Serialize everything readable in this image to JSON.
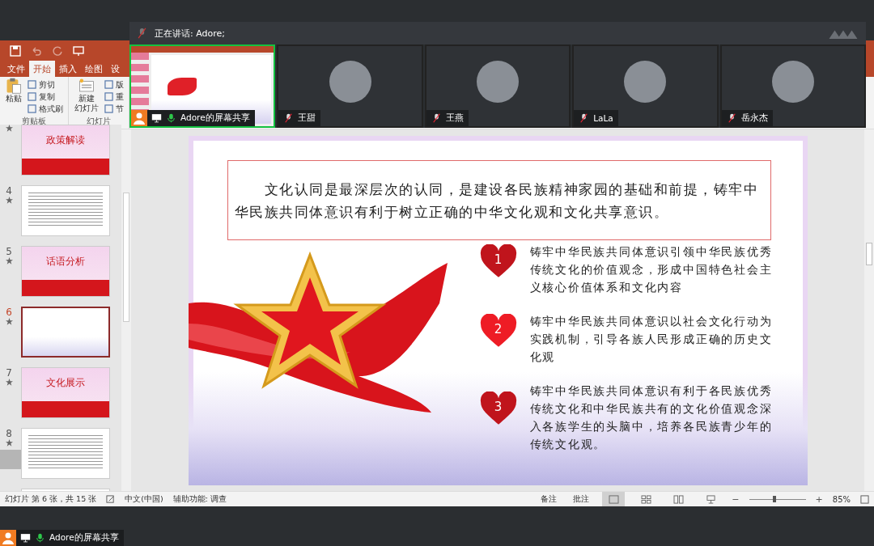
{
  "meeting": {
    "speaking": "正在讲话: Adore;",
    "tiles": [
      {
        "kind": "screen",
        "name": "Adore的屏幕共享",
        "selected": true
      },
      {
        "kind": "avatar",
        "name": "王甜",
        "selected": false
      },
      {
        "kind": "avatar",
        "name": "王燕",
        "selected": false
      },
      {
        "kind": "avatar",
        "name": "LaLa",
        "selected": false
      },
      {
        "kind": "avatar",
        "name": "岳永杰",
        "selected": false
      }
    ]
  },
  "tabs": [
    {
      "label": "文件",
      "selected": false
    },
    {
      "label": "开始",
      "selected": true
    },
    {
      "label": "插入",
      "selected": false
    },
    {
      "label": "绘图",
      "selected": false
    },
    {
      "label": "设",
      "selected": false
    }
  ],
  "ribbon": {
    "groups": [
      {
        "label": "剪贴板",
        "big": [
          "粘贴"
        ],
        "items": [
          "剪切",
          "复制",
          "格式刷"
        ]
      },
      {
        "label": "幻灯片",
        "big": [
          "新建",
          "幻灯片"
        ],
        "items": [
          "版",
          "重",
          "节"
        ]
      }
    ]
  },
  "thumbnails": [
    {
      "kind": "title",
      "title": "政策解读",
      "selected": false
    },
    {
      "kind": "text",
      "number": "4",
      "selected": false
    },
    {
      "kind": "title",
      "number": "5",
      "title": "话语分析",
      "selected": false
    },
    {
      "kind": "current",
      "number": "6",
      "selected": true
    },
    {
      "kind": "title",
      "number": "7",
      "title": "文化展示",
      "selected": false
    },
    {
      "kind": "text",
      "number": "8",
      "selected": false
    },
    {
      "kind": "partial",
      "selected": false
    }
  ],
  "slide": {
    "intro": "文化认同是最深层次的认同，是建设各民族精神家园的基础和前提，铸牢中华民族共同体意识有利于树立正确的中华文化观和文化共享意识。",
    "points": [
      {
        "number": "1",
        "color": "#c0141c",
        "text": "铸牢中华民族共同体意识引领中华民族优秀传统文化的价值观念，形成中国特色社会主义核心价值体系和文化内容"
      },
      {
        "number": "2",
        "color": "#ee1c25",
        "text": "铸牢中华民族共同体意识以社会文化行动为实践机制，引导各族人民形成正确的历史文化观"
      },
      {
        "number": "3",
        "color": "#c0141c",
        "text": "铸牢中华民族共同体意识有利于各民族优秀传统文化和中华民族共有的文化价值观念深入各族学生的头脑中，培养各民族青少年的传统文化观。"
      }
    ]
  },
  "status_bar": {
    "slide_info": "幻灯片 第 6 张，共 15 张",
    "language": "中文(中国)",
    "accessibility": "辅助功能: 调查",
    "notes": "备注",
    "comments": "批注",
    "views": [
      {
        "kind": "normal",
        "selected": true
      },
      {
        "kind": "sorter",
        "selected": false
      },
      {
        "kind": "reading",
        "selected": false
      },
      {
        "kind": "show",
        "selected": false
      }
    ],
    "zoom_out": "−",
    "zoom_in": "+",
    "zoom": {
      "level": 0.45
    },
    "zoom_reading": "85%"
  },
  "share_label": "Adore的屏幕共享"
}
